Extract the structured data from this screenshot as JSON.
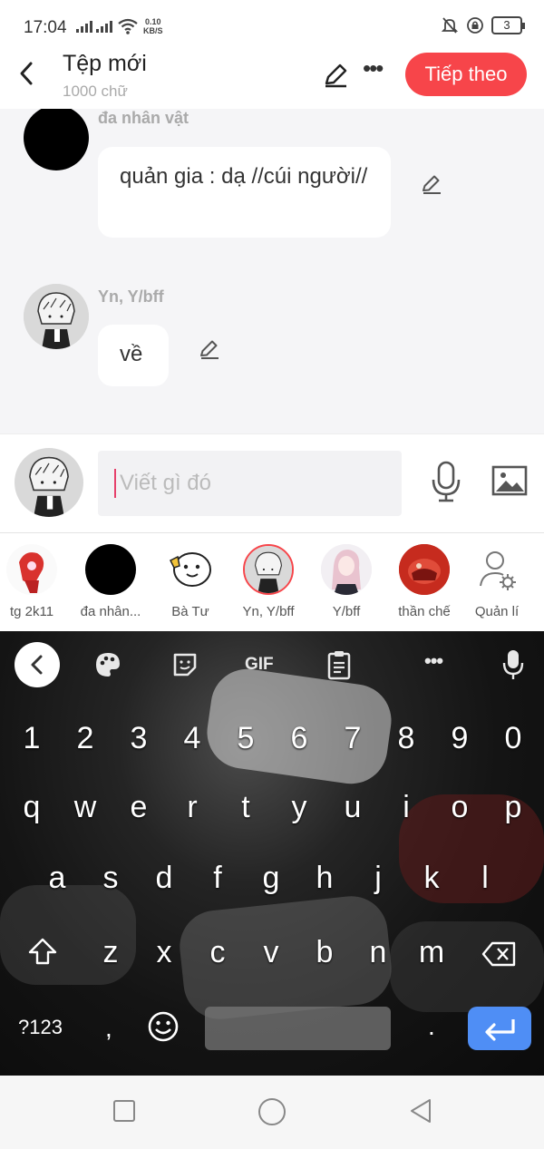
{
  "status": {
    "time": "17:04",
    "speed_value": "0.10",
    "speed_unit": "KB/S",
    "battery": "3"
  },
  "header": {
    "title": "Tệp mới",
    "subtitle": "1000 chữ",
    "next_label": "Tiếp theo"
  },
  "messages": [
    {
      "sender": "đa nhân vật",
      "text": "quản gia : dạ //cúi người//"
    },
    {
      "sender": "Yn, Y/bff",
      "text": "về"
    }
  ],
  "input": {
    "placeholder": "Viết gì đó"
  },
  "characters": [
    {
      "label": "tg 2k11"
    },
    {
      "label": "đa nhân..."
    },
    {
      "label": "Bà Tư"
    },
    {
      "label": "Yn, Y/bff"
    },
    {
      "label": "Y/bff"
    },
    {
      "label": "thần chế"
    },
    {
      "label": "Quản lí"
    }
  ],
  "keyboard": {
    "gif_label": "GIF",
    "row_numbers": [
      "1",
      "2",
      "3",
      "4",
      "5",
      "6",
      "7",
      "8",
      "9",
      "0"
    ],
    "row_top": [
      "q",
      "w",
      "e",
      "r",
      "t",
      "y",
      "u",
      "i",
      "o",
      "p"
    ],
    "row_mid": [
      "a",
      "s",
      "d",
      "f",
      "g",
      "h",
      "j",
      "k",
      "l"
    ],
    "row_bottom": [
      "z",
      "x",
      "c",
      "v",
      "b",
      "n",
      "m"
    ],
    "symbols_label": "?123",
    "comma": ",",
    "period": "."
  },
  "colors": {
    "accent": "#f7454a",
    "enter_key": "#4f8ef5",
    "caret": "#e6416b"
  }
}
